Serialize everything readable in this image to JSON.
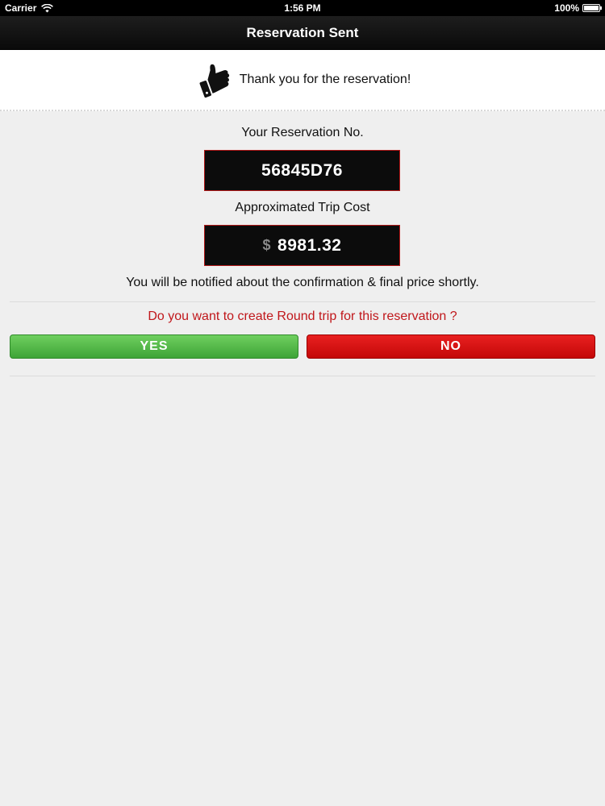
{
  "status_bar": {
    "carrier": "Carrier",
    "time": "1:56 PM",
    "battery": "100%",
    "battery_level": 1.0
  },
  "nav": {
    "title": "Reservation Sent"
  },
  "thanks": {
    "icon": "thumbs-up-icon",
    "text": "Thank you for the reservation!"
  },
  "reservation": {
    "label": "Your Reservation No.",
    "number": "56845D76"
  },
  "cost": {
    "label": "Approximated Trip Cost",
    "currency": "$",
    "amount": "8981.32"
  },
  "notice": "You will be notified about the confirmation & final price shortly.",
  "round_trip": {
    "question": "Do you want to create Round trip for this reservation ?",
    "yes_label": "YES",
    "no_label": "NO"
  },
  "colors": {
    "accent_red": "#c0171b",
    "yes_green": "#4fb845",
    "no_red": "#d41010"
  }
}
